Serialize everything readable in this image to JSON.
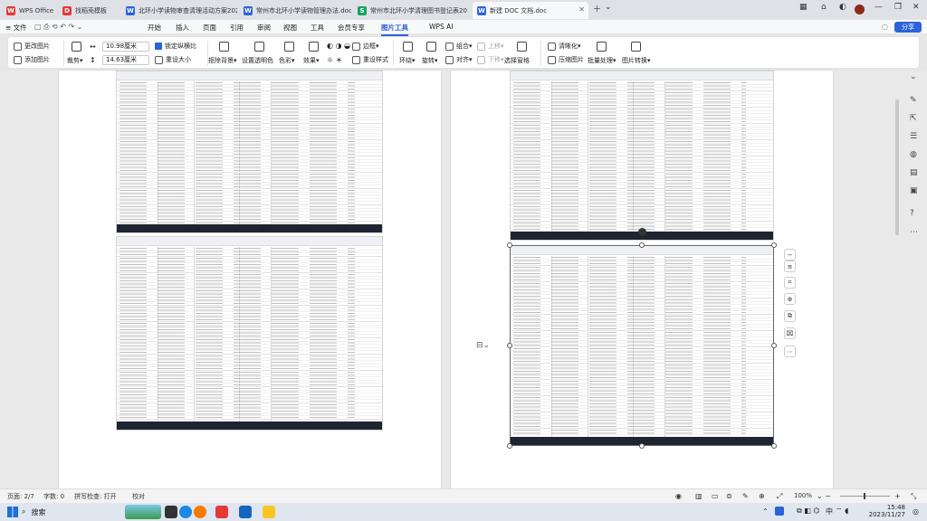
{
  "tabs": [
    {
      "label": "WPS Office",
      "icon": "wps-logo-icon",
      "color": "#e53935"
    },
    {
      "label": "找稻壳模板",
      "icon": "docer-icon",
      "color": "#e53935"
    },
    {
      "label": "北环小学读物审查清理活动方案2023",
      "icon": "w",
      "color": "#2b63d9"
    },
    {
      "label": "常州市北环小学读物管理办法.doc",
      "icon": "w",
      "color": "#2b63d9"
    },
    {
      "label": "常州市北环小学清理图书登记表20",
      "icon": "s",
      "color": "#1aa260"
    },
    {
      "label": "新建 DOC 文档.doc",
      "icon": "w",
      "color": "#2b63d9"
    }
  ],
  "menu": {
    "file": "≡ 文件",
    "items": [
      "开始",
      "插入",
      "页面",
      "引用",
      "审阅",
      "视图",
      "工具",
      "会员专享",
      "图片工具"
    ],
    "selected": "图片工具",
    "wps_ai": "WPS AI",
    "share": "分享"
  },
  "ribbon": {
    "change_image": "更改图片",
    "add_image": "添加图片",
    "crop": "裁剪",
    "width": "10.98厘米",
    "height": "14.63厘米",
    "lock_ratio": "锁定纵横比",
    "reset_size": "重设大小",
    "remove_bg": "抠除背景",
    "set_transparent": "设置透明色",
    "color": "色彩",
    "effects": "效果",
    "border": "边框",
    "reset_style": "重设样式",
    "wrap": "环绕",
    "rotate": "旋转",
    "align": "对齐",
    "group": "组合",
    "bring_forward": "上移",
    "send_backward": "下移",
    "selection_pane": "选择窗格",
    "sharpen": "清晰化",
    "compress": "压缩图片",
    "batch": "批量处理",
    "convert": "图片转换"
  },
  "status": {
    "page": "页面: 2/7",
    "words": "字数: 0",
    "spell": "拼写检查: 打开",
    "proof": "校对",
    "zoom": "100%"
  },
  "taskbar": {
    "search": "搜索",
    "time": "15:48",
    "date": "2023/11/27",
    "lang": "中"
  }
}
